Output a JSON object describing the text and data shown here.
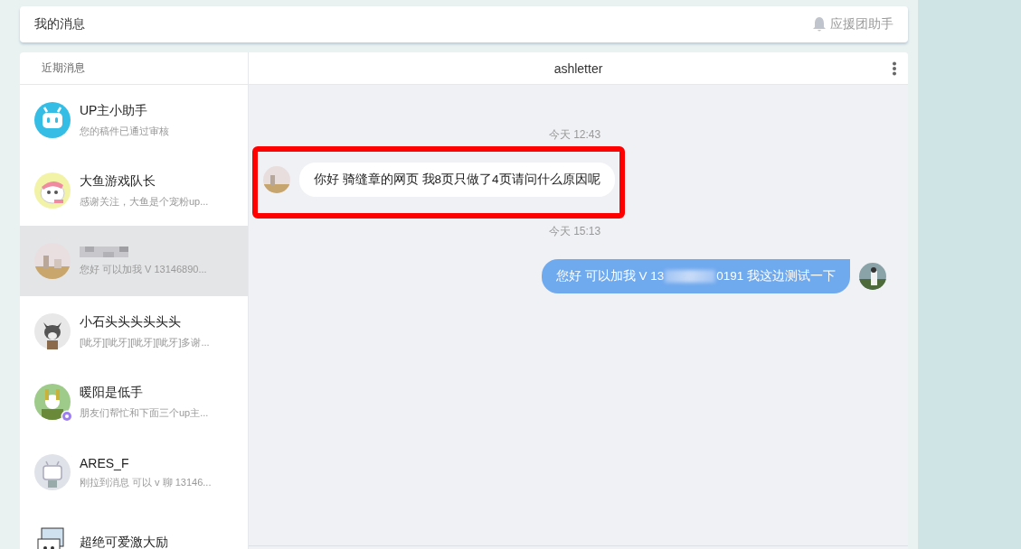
{
  "header": {
    "title": "我的消息",
    "assistant": "应援团助手"
  },
  "sidebar": {
    "title": "近期消息",
    "items": [
      {
        "avatar": {
          "kind": "robot"
        },
        "name": "UP主小助手",
        "preview": "您的稿件已通过审核",
        "selected": false
      },
      {
        "avatar": {
          "kind": "cartoon"
        },
        "name": "大鱼游戏队长",
        "preview": "感谢关注，大鱼是个宠粉up...",
        "selected": false
      },
      {
        "avatar": {
          "kind": "photo"
        },
        "name_blurred": true,
        "preview": "您好 可以加我 V 13146890...",
        "selected": true
      },
      {
        "avatar": {
          "kind": "wolf"
        },
        "name": "小石头头头头头头",
        "preview": "[呲牙][呲牙][呲牙][呲牙]多谢...",
        "selected": false
      },
      {
        "avatar": {
          "kind": "green"
        },
        "name": "暖阳是低手",
        "preview": "朋友们帮忙和下面三个up主...",
        "selected": false,
        "badge": true
      },
      {
        "avatar": {
          "kind": "tv"
        },
        "name": "ARES_F",
        "preview": "刚拉到消息 可以 v 聊 13146...",
        "selected": false
      },
      {
        "avatar": {
          "kind": "sketch"
        },
        "name": "超绝可爱激大励",
        "selected": false
      }
    ]
  },
  "chat": {
    "title": "ashletter",
    "messages": [
      {
        "kind": "time",
        "text": "今天 12:43"
      },
      {
        "kind": "incoming",
        "text": "你好 骑缝章的网页 我8页只做了4页请问什么原因呢",
        "highlighted": true
      },
      {
        "kind": "time",
        "text": "今天 15:13"
      },
      {
        "kind": "outgoing",
        "text_before": "您好 可以加我 V 13",
        "text_after": "0191 我这边测试一下",
        "redacted": true
      }
    ]
  }
}
